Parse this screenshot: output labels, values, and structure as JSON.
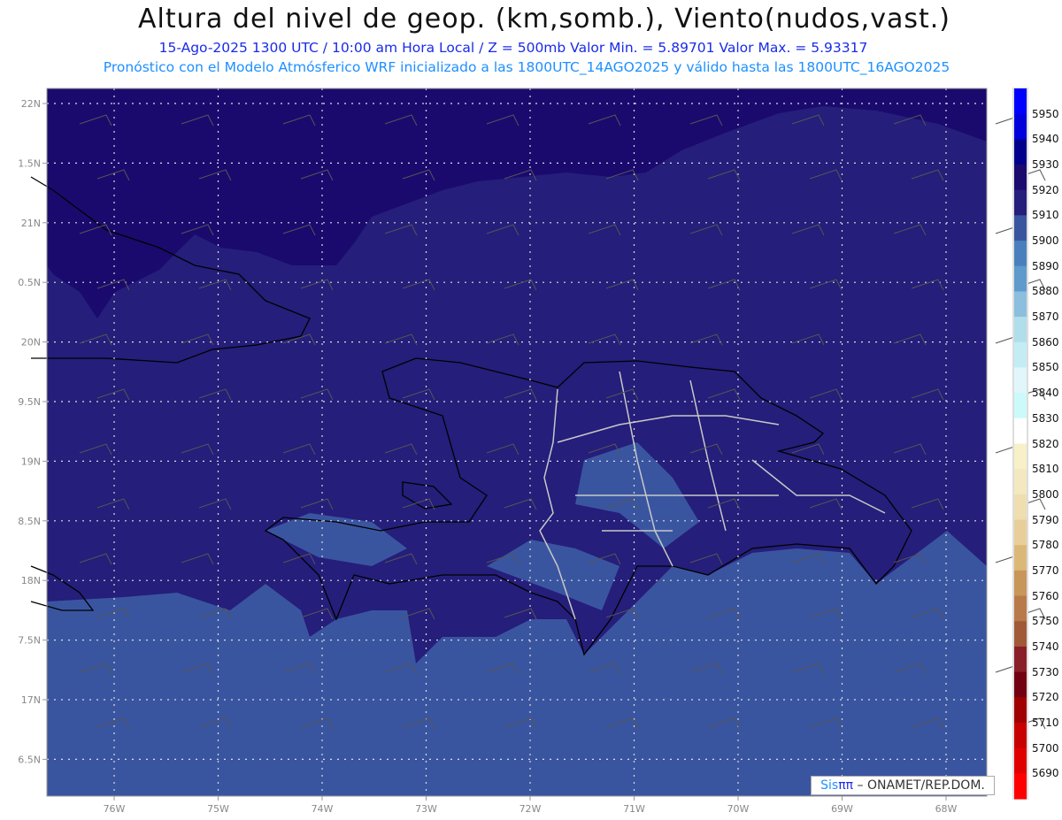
{
  "header": {
    "title": "Altura del nivel de geop. (km,somb.), Viento(nudos,vast.)",
    "subtitle_line1": "15-Ago-2025  1300 UTC / 10:00 am Hora Local / Z = 500mb    Valor Min. = 5.89701   Valor Max. = 5.93317",
    "subtitle_line2": "Pronóstico con el Modelo Atmósferico WRF inicializado a las 1800UTC_14AGO2025 y válido hasta las  1800UTC_16AGO2025"
  },
  "axes": {
    "lat_labels": [
      "22N",
      "1.5N",
      "21N",
      "0.5N",
      "20N",
      "9.5N",
      "19N",
      "8.5N",
      "18N",
      "7.5N",
      "17N",
      "6.5N"
    ],
    "lon_labels": [
      "76W",
      "75W",
      "74W",
      "73W",
      "72W",
      "71W",
      "70W",
      "69W",
      "68W"
    ]
  },
  "colorbar": {
    "labels": [
      "5950",
      "5940",
      "5930",
      "5920",
      "5910",
      "5900",
      "5890",
      "5880",
      "5870",
      "5860",
      "5850",
      "5840",
      "5830",
      "5820",
      "5810",
      "5800",
      "5790",
      "5780",
      "5770",
      "5760",
      "5750",
      "5740",
      "5730",
      "5720",
      "5710",
      "5700",
      "5690"
    ],
    "colors": [
      "#0000ff",
      "#0000dd",
      "#00008c",
      "#1a0a6e",
      "#251e7a",
      "#3a55a0",
      "#4a7fbd",
      "#5e9acb",
      "#8bbfdd",
      "#b0deea",
      "#c4ecf4",
      "#e0f6fa",
      "#ccfafa",
      "#ffffff",
      "#f7f0c8",
      "#f3e8c0",
      "#efdeb0",
      "#e8cf9a",
      "#dcb878",
      "#c89658",
      "#b87a48",
      "#a05a38",
      "#8a1e28",
      "#720010",
      "#a00000",
      "#c80000",
      "#e00000",
      "#ff0000"
    ]
  },
  "credit": {
    "logo": "Sis",
    "logo_pi": "ππ",
    "text": " – ONAMET/REP.DOM."
  }
}
